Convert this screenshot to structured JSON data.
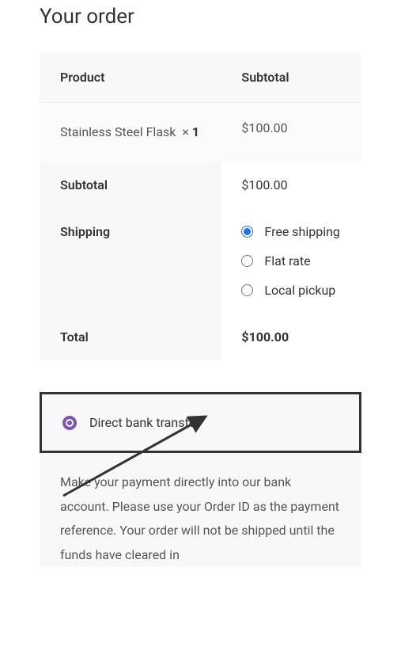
{
  "heading": "Your order",
  "table": {
    "headers": {
      "product": "Product",
      "subtotal": "Subtotal"
    },
    "item": {
      "name": "Stainless Steel Flask",
      "qty_prefix": "×",
      "qty": "1",
      "subtotal": "$100.00"
    },
    "footer": {
      "subtotal_label": "Subtotal",
      "subtotal_value": "$100.00",
      "shipping_label": "Shipping",
      "shipping_options": {
        "free": "Free shipping",
        "flat": "Flat rate",
        "local": "Local pickup"
      },
      "total_label": "Total",
      "total_value": "$100.00"
    }
  },
  "payment": {
    "method_label": "Direct bank transfer",
    "description": "Make your payment directly into our bank account. Please use your Order ID as the payment reference. Your order will not be shipped until the funds have cleared in"
  }
}
